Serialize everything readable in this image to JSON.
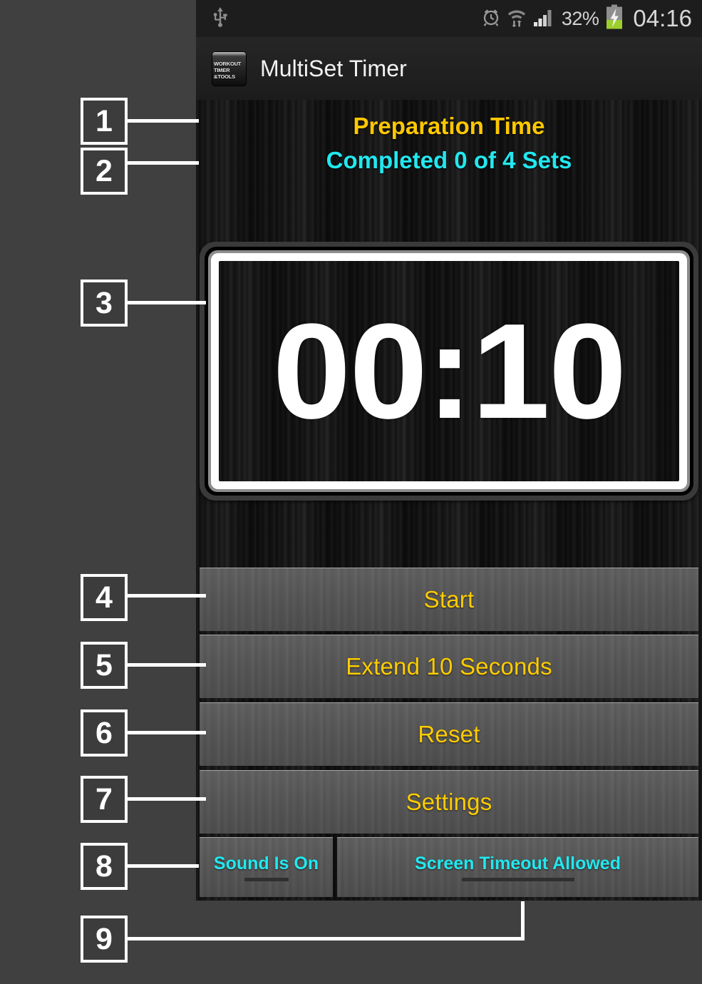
{
  "statusbar": {
    "usb_icon": "usb-icon",
    "alarm_icon": "alarm-clock-icon",
    "wifi_icon": "wifi-icon",
    "signal_icon": "cellular-signal-icon",
    "battery_percent": "32%",
    "battery_icon": "battery-charging-icon",
    "clock": "04:16"
  },
  "actionbar": {
    "app_icon": "app-logo-icon",
    "app_icon_text_1": "WORKOUT",
    "app_icon_text_2": "TIMER",
    "app_icon_text_3": "&TOOLS",
    "title": "MultiSet Timer"
  },
  "main": {
    "phase_label": "Preparation Time",
    "sets_label": "Completed 0 of 4 Sets",
    "timer_value": "00:10"
  },
  "buttons": {
    "start": "Start",
    "extend": "Extend 10 Seconds",
    "reset": "Reset",
    "settings": "Settings",
    "sound_toggle": "Sound Is On",
    "screen_timeout_toggle": "Screen Timeout Allowed"
  },
  "colors": {
    "accent_yellow": "#ffcc00",
    "accent_cyan": "#22e8ef",
    "button_gray": "#565656",
    "page_background": "#404040",
    "screen_background": "#131313"
  },
  "annotations": [
    {
      "number": "1",
      "target": "phase-label"
    },
    {
      "number": "2",
      "target": "sets-label"
    },
    {
      "number": "3",
      "target": "timer-display"
    },
    {
      "number": "4",
      "target": "start-button"
    },
    {
      "number": "5",
      "target": "extend-button"
    },
    {
      "number": "6",
      "target": "reset-button"
    },
    {
      "number": "7",
      "target": "settings-button"
    },
    {
      "number": "8",
      "target": "sound-toggle-button"
    },
    {
      "number": "9",
      "target": "screen-timeout-toggle-button"
    }
  ]
}
